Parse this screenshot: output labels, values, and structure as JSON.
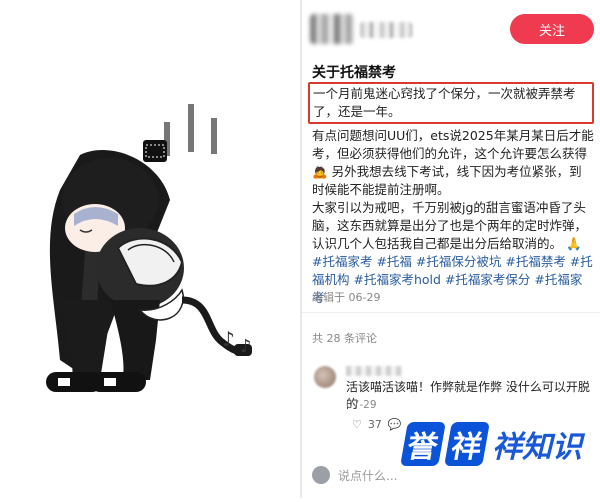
{
  "post": {
    "title": "关于托福禁考",
    "follow_label": "关注",
    "p1": "一个月前鬼迷心窍找了个保分，一次就被弄禁考了，还是一年。",
    "p2": "有点问题想问UU们，ets说2025年某月某日后才能考，但必须获得他们的允许，这个允许要怎么获得",
    "p2b": "另外我想去线下考试，线下因为考位紧张，到时候能不能提前注册啊。",
    "p3": "大家引以为戒吧，千万别被jg的甜言蜜语冲昏了头脑，这东西就算是出分了也是个两年的定时炸弹，认识几个人包括我自己都是出分后给取消的。",
    "tags": "#托福家考 #托福 #托福保分被坑 #托福禁考 #托福机构 #托福家考hold #托福家考保分 #托福家考",
    "edited": "编辑于 06-29"
  },
  "comments": {
    "count_label": "共 28 条评论",
    "items": [
      {
        "text": "活该喵活该喵！作弊就是作弊 没什么可以开脱的",
        "date": "07-29",
        "likes": "37"
      }
    ],
    "input_placeholder": "说点什么..."
  },
  "watermark": {
    "blocks": [
      "誉",
      "祥"
    ],
    "text": "祥知识"
  },
  "colors": {
    "follow_bg": "#ef3a4f",
    "highlight_border": "#d9382c",
    "tag": "#2a5d9f",
    "watermark": "#0b53d8"
  },
  "icons": [
    "heart-icon",
    "comment-icon",
    "chat-bubble-icon"
  ]
}
